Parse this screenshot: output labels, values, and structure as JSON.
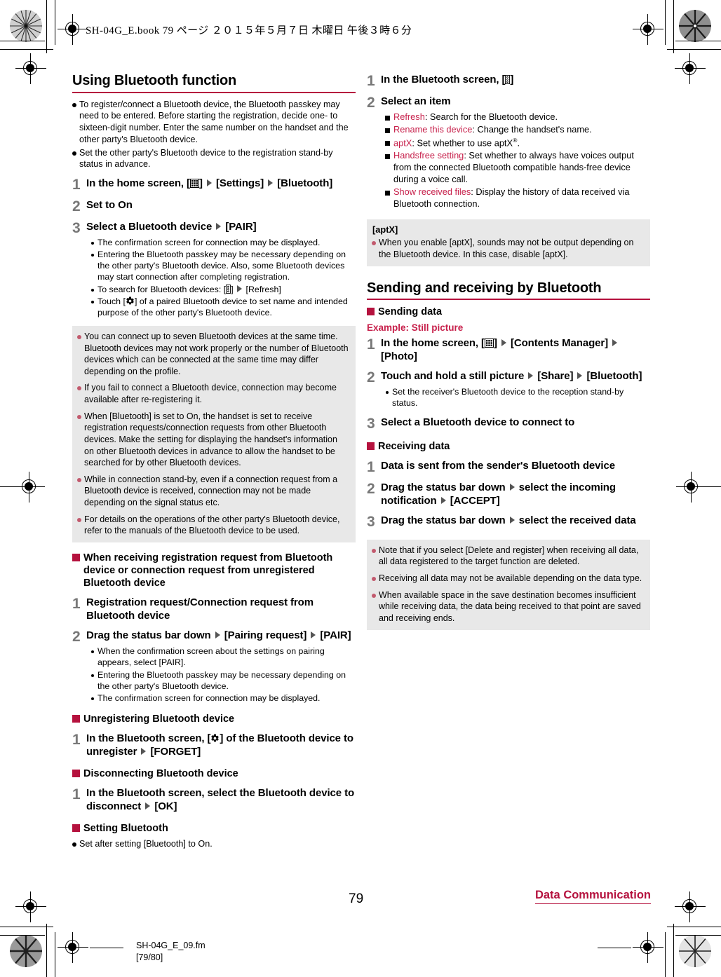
{
  "print_header": "SH-04G_E.book  79 ページ  ２０１５年５月７日  木曜日  午後３時６分",
  "footer": {
    "page_number": "79",
    "chapter": "Data Communication",
    "filename": "SH-04G_E_09.fm",
    "file_page_range": "[79/80]"
  },
  "colors": {
    "accent": "#b5123e",
    "item_name": "#c7204b",
    "note_bullet": "#c25a6e",
    "note_background": "#e8e8e8",
    "step_number": "#787878"
  },
  "left_column": {
    "section_title": "Using Bluetooth function",
    "intro_bullets": [
      "To register/connect a Bluetooth device, the Bluetooth passkey may need to be entered. Before starting the registration, decide one- to sixteen-digit number. Enter the same number on the handset and the other party's Bluetooth device.",
      "Set the other party's Bluetooth device to the registration stand-by status in advance."
    ],
    "steps": {
      "s1_num": "1",
      "s1_a": "In the home screen, [",
      "s1_b": "] ",
      "s1_c": " [Settings] ",
      "s1_d": " [Bluetooth]",
      "s2_num": "2",
      "s2_text": "Set to On",
      "s3_num": "3",
      "s3_a": "Select a Bluetooth device ",
      "s3_b": " [PAIR]"
    },
    "step3_bullets": [
      "The confirmation screen for connection may be displayed.",
      "Entering the Bluetooth passkey may be necessary depending on the other party's Bluetooth device. Also, some Bluetooth devices may start connection after completing registration."
    ],
    "step3_bullet_refresh_a": "To search for Bluetooth devices: [",
    "step3_bullet_refresh_b": "] ",
    "step3_bullet_refresh_c": " [Refresh]",
    "step3_bullet_gear_a": "Touch [",
    "step3_bullet_gear_b": "] of a paired Bluetooth device to set name and intended purpose of the other party's Bluetooth device.",
    "notes": [
      "You can connect up to seven Bluetooth devices at the same time. Bluetooth devices may not work properly or the number of Bluetooth devices which can be connected at the same time may differ depending on the profile.",
      "If you fail to connect a Bluetooth device, connection may become available after re-registering it.",
      "When [Bluetooth] is set to On, the handset is set to receive registration requests/connection requests from other Bluetooth devices. Make the setting for displaying the handset's information on other Bluetooth devices in advance to allow the handset to be searched for by other Bluetooth devices.",
      "While in connection stand-by, even if a connection request from a Bluetooth device is received, connection may not be made depending on the signal status etc.",
      "For details on the operations of the other party's Bluetooth device, refer to the manuals of the Bluetooth device to be used."
    ],
    "sub_receiving_request": {
      "heading": "When receiving registration request from Bluetooth device or connection request from unregistered Bluetooth device",
      "s1_num": "1",
      "s1_text": "Registration request/Connection request from Bluetooth device",
      "s2_num": "2",
      "s2_a": "Drag the status bar down ",
      "s2_b": " [Pairing request] ",
      "s2_c": " [PAIR]",
      "bullets": [
        "When the confirmation screen about the settings on pairing appears, select [PAIR].",
        "Entering the Bluetooth passkey may be necessary depending on the other party's Bluetooth device.",
        "The confirmation screen for connection may be displayed."
      ]
    },
    "sub_unregistering": {
      "heading": "Unregistering Bluetooth device",
      "s1_num": "1",
      "s1_a": "In the Bluetooth screen, [",
      "s1_b": "] of the Bluetooth device to unregister ",
      "s1_c": " [FORGET]"
    },
    "sub_disconnecting": {
      "heading": "Disconnecting Bluetooth device",
      "s1_num": "1",
      "s1_a": "In the Bluetooth screen, select the Bluetooth device to disconnect ",
      "s1_b": " [OK]"
    },
    "sub_setting": {
      "heading": "Setting Bluetooth",
      "bullet": "Set after setting [Bluetooth] to On."
    }
  },
  "right_column": {
    "steps": {
      "s1_num": "1",
      "s1_a": "In the Bluetooth screen, [",
      "s1_b": "]",
      "s2_num": "2",
      "s2_text": "Select an item"
    },
    "items": [
      {
        "name": "Refresh",
        "desc": ": Search for the Bluetooth device."
      },
      {
        "name": "Rename this device",
        "desc": ": Change the handset's name."
      },
      {
        "name": "aptX",
        "desc": ": Set whether to use aptX",
        "sup": "®",
        "desc_tail": "."
      },
      {
        "name": "Handsfree setting",
        "desc": ": Set whether to always have voices output from the connected Bluetooth compatible hands-free device during a voice call."
      },
      {
        "name": "Show received files",
        "desc": ": Display the history of data received via Bluetooth connection."
      }
    ],
    "aptx_note": {
      "title": "[aptX]",
      "text": "When you enable [aptX], sounds may not be output depending on the Bluetooth device. In this case, disable [aptX]."
    },
    "section_title": "Sending and receiving by Bluetooth",
    "sending": {
      "heading": "Sending data",
      "example_label": "Example: Still picture",
      "s1_num": "1",
      "s1_a": "In the home screen, [",
      "s1_b": "] ",
      "s1_c": " [Contents Manager] ",
      "s1_d": " [Photo]",
      "s2_num": "2",
      "s2_a": "Touch and hold a still picture ",
      "s2_b": " [Share] ",
      "s2_c": " [Bluetooth]",
      "s2_bullet": "Set the receiver's Bluetooth device to the reception stand-by status.",
      "s3_num": "3",
      "s3_text": "Select a Bluetooth device to connect to"
    },
    "receiving": {
      "heading": "Receiving data",
      "s1_num": "1",
      "s1_text": "Data is sent from the sender's Bluetooth device",
      "s2_num": "2",
      "s2_a": "Drag the status bar down ",
      "s2_b": " select the incoming notification ",
      "s2_c": " [ACCEPT]",
      "s3_num": "3",
      "s3_a": "Drag the status bar down ",
      "s3_b": " select the received data",
      "notes": [
        "Note that if you select [Delete and register] when receiving all data, all data registered to the target function are deleted.",
        "Receiving all data may not be available depending on the data type.",
        "When available space in the save destination becomes insufficient while receiving data, the data being received to that point are saved and receiving ends."
      ]
    }
  }
}
